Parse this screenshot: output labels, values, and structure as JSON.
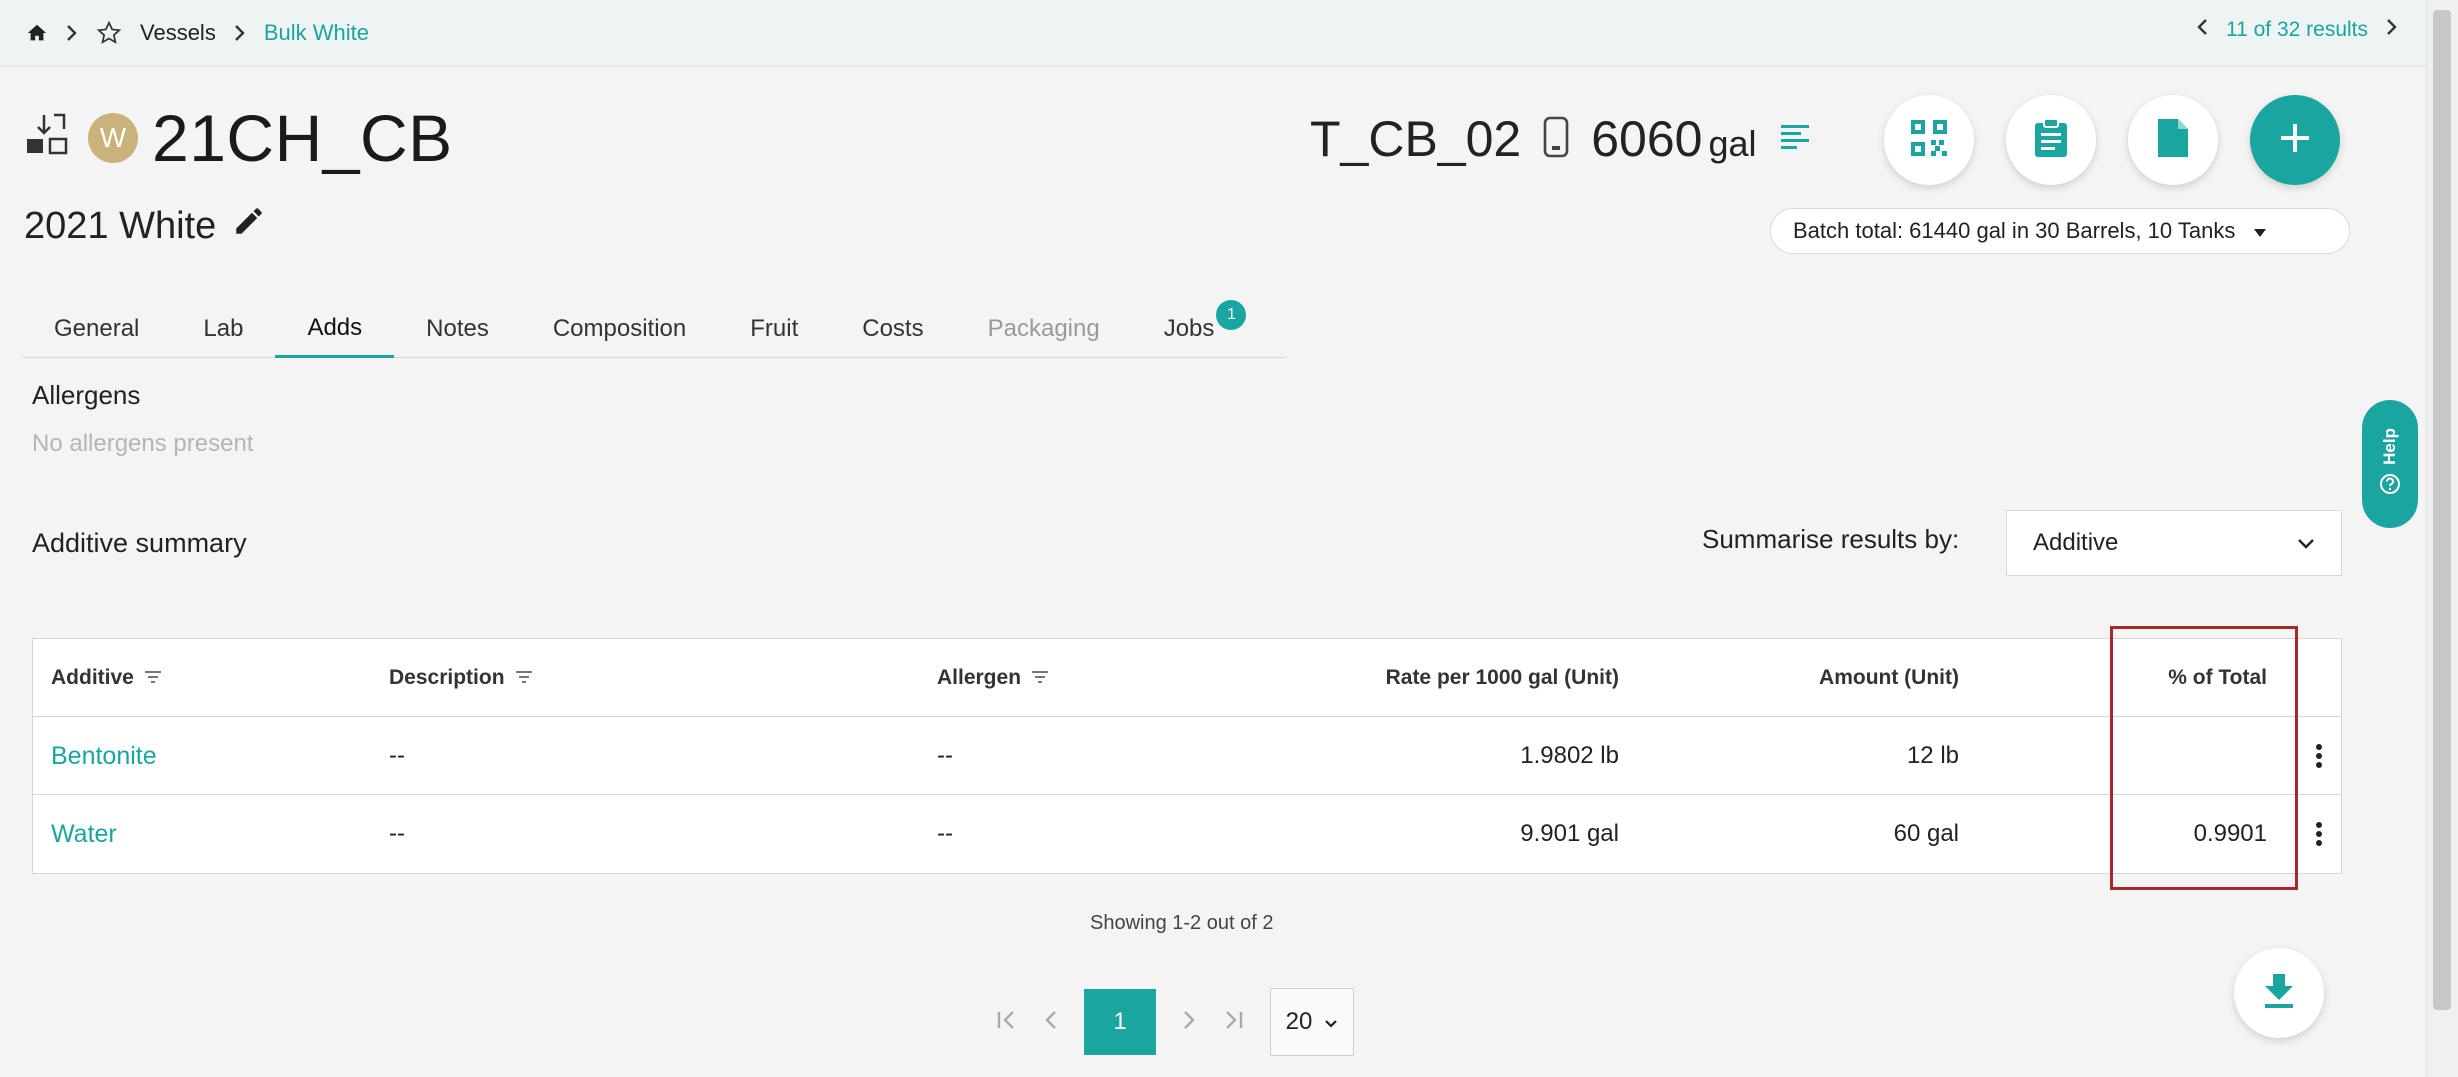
{
  "breadcrumb": {
    "home_icon": "home-icon",
    "star_icon": "star-icon",
    "vessels": "Vessels",
    "current": "Bulk White"
  },
  "top_pager": {
    "text": "11 of 32 results"
  },
  "vessel": {
    "badge": "W",
    "code": "21CH_CB",
    "batch": "2021 White"
  },
  "tank": {
    "code": "T_CB_02",
    "volume": "6060",
    "unit": "gal"
  },
  "batch_total": "Batch total: 61440 gal in 30 Barrels, 10 Tanks",
  "tabs": [
    {
      "label": "General"
    },
    {
      "label": "Lab"
    },
    {
      "label": "Adds"
    },
    {
      "label": "Notes"
    },
    {
      "label": "Composition"
    },
    {
      "label": "Fruit"
    },
    {
      "label": "Costs"
    },
    {
      "label": "Packaging"
    },
    {
      "label": "Jobs",
      "badge": "1"
    }
  ],
  "allergens": {
    "title": "Allergens",
    "empty": "No allergens present"
  },
  "summary": {
    "title": "Additive summary",
    "summarise_label": "Summarise results by:",
    "summarise_value": "Additive"
  },
  "table": {
    "headers": [
      "Additive",
      "Description",
      "Allergen",
      "Rate per 1000 gal (Unit)",
      "Amount (Unit)",
      "% of Total"
    ],
    "rows": [
      {
        "additive": "Bentonite",
        "description": "--",
        "allergen": "--",
        "rate": "1.9802 lb",
        "amount": "12 lb",
        "pct": ""
      },
      {
        "additive": "Water",
        "description": "--",
        "allergen": "--",
        "rate": "9.901 gal",
        "amount": "60 gal",
        "pct": "0.9901"
      }
    ]
  },
  "showing": "Showing 1-2 out of 2",
  "pagination": {
    "page": "1",
    "page_size": "20"
  },
  "help": "Help",
  "colors": {
    "accent": "#1aa5a0",
    "highlight": "#a52a2a"
  }
}
